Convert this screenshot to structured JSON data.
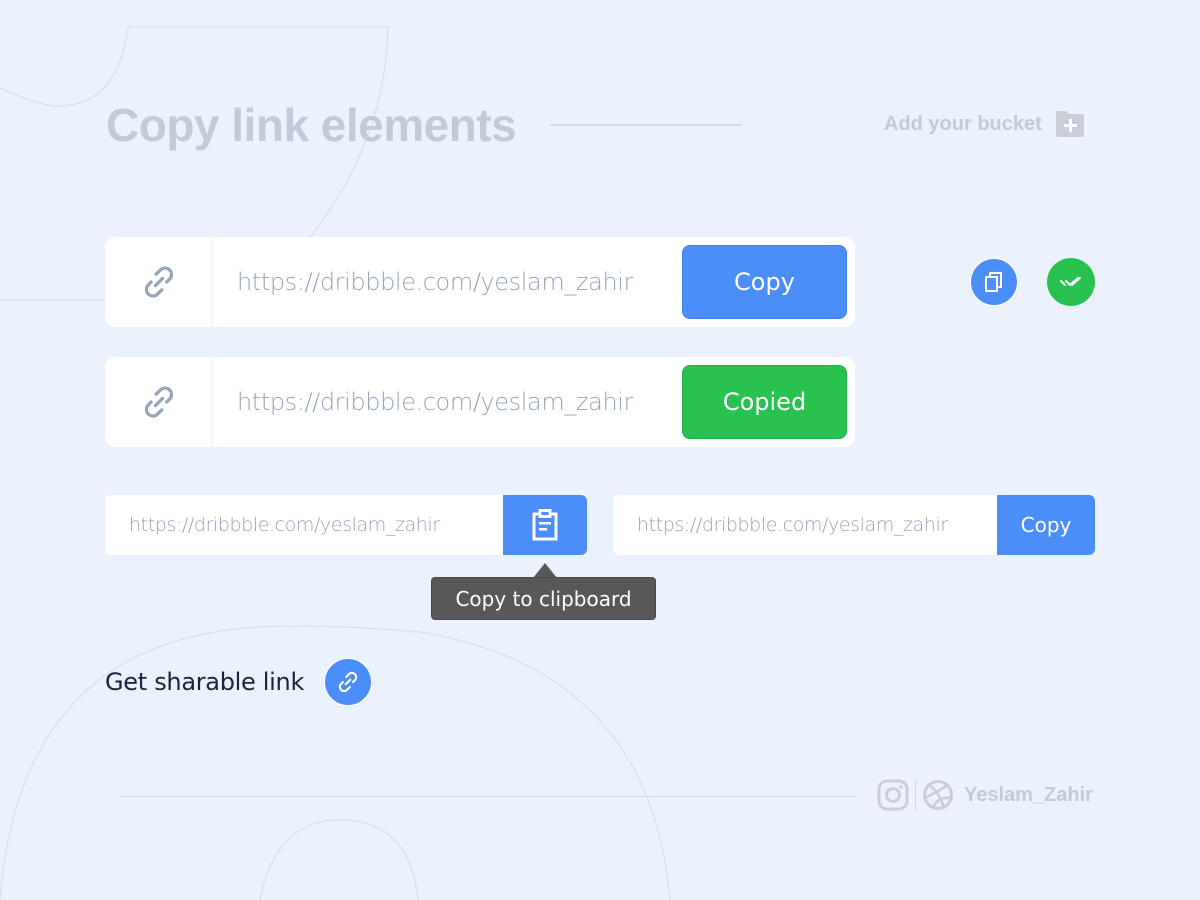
{
  "header": {
    "title": "Copy link elements",
    "bucket_label": "Add your bucket",
    "bucket_icon": "folder-plus-icon"
  },
  "large_fields": [
    {
      "icon": "link-icon",
      "url": "https://dribbble.com/yeslam_zahir",
      "button_label": "Copy",
      "state": "default",
      "button_color": "#4b8ef9"
    },
    {
      "icon": "link-icon",
      "url": "https://dribbble.com/yeslam_zahir",
      "button_label": "Copied",
      "state": "copied",
      "button_color": "#28c251"
    }
  ],
  "icon_buttons": [
    {
      "icon": "copy-icon",
      "color": "#4b8ef9"
    },
    {
      "icon": "double-check-icon",
      "color": "#28c251"
    }
  ],
  "small_fields": [
    {
      "url": "https://dribbble.com/yeslam_zahir",
      "button_icon": "clipboard-icon",
      "tooltip": "Copy to clipboard"
    },
    {
      "url": "https://dribbble.com/yeslam_zahir",
      "button_label": "Copy"
    }
  ],
  "share": {
    "label": "Get sharable link",
    "icon": "link-icon"
  },
  "footer": {
    "icons": [
      "instagram-icon",
      "dribbble-icon"
    ],
    "username": "Yeslam_Zahir"
  },
  "colors": {
    "background": "#ebf1fd",
    "primary": "#4b8ef9",
    "success": "#28c251",
    "muted_text": "#c3cad9",
    "url_text": "#97a4bb",
    "tooltip_bg": "#585858"
  }
}
